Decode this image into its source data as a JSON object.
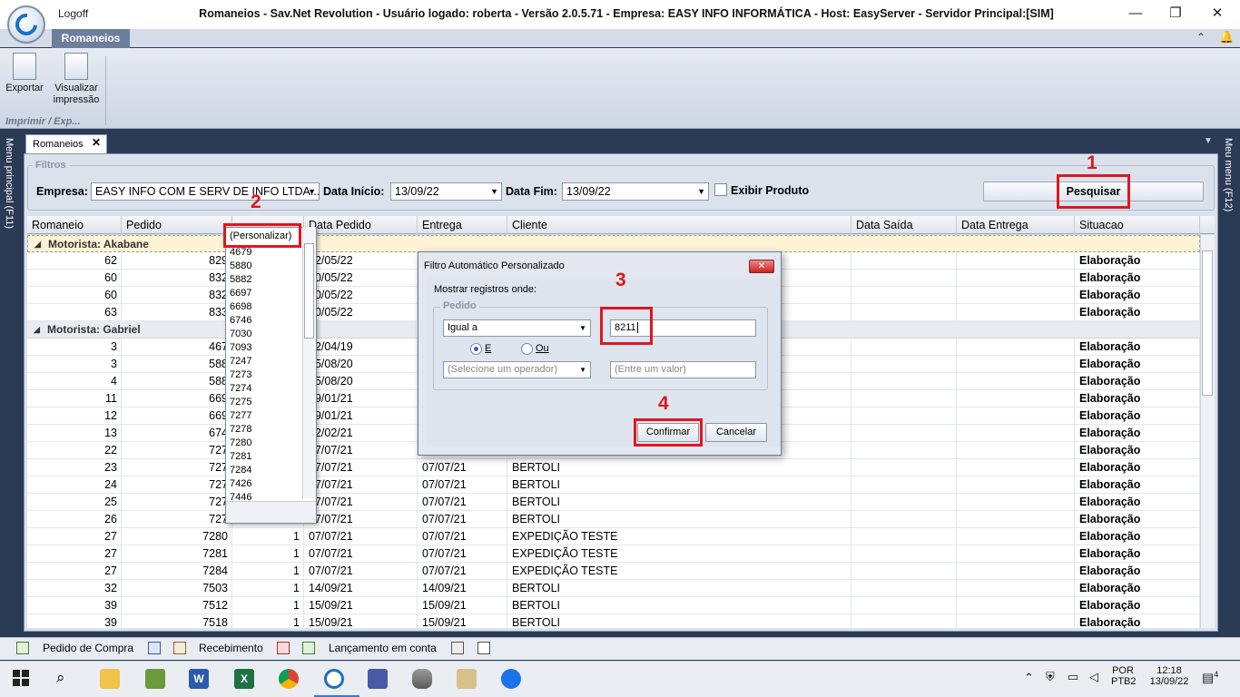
{
  "titlebar": {
    "logoff": "Logoff",
    "title": "Romaneios - Sav.Net Revolution - Usuário logado: roberta - Versão 2.0.5.71 - Empresa: EASY INFO INFORMÁTICA - Host: EasyServer - Servidor Principal:[SIM]",
    "minimize": "—",
    "restore": "❐",
    "close": "✕"
  },
  "ribbon": {
    "tab": "Romaneios",
    "buttons": [
      {
        "label1": "Exportar",
        "label2": "",
        "icon": "floppy-disk-icon"
      },
      {
        "label1": "Visualizar",
        "label2": "impressão",
        "icon": "print-preview-icon"
      }
    ],
    "group_label": "Imprimir / Exp..."
  },
  "side": {
    "left": "Menu principal (F11)",
    "right": "Meu menu (F12)"
  },
  "doc_tab": {
    "label": "Romaneios",
    "close": "✕"
  },
  "filters": {
    "legend": "Filtros",
    "empresa_label": "Empresa:",
    "empresa_value": "EASY INFO COM E SERV DE INFO LTDA...",
    "inicio_label": "Data Início:",
    "inicio_value": "13/09/22",
    "fim_label": "Data Fim:",
    "fim_value": "13/09/22",
    "exibir_label": "Exibir Produto",
    "pesquisar": "Pesquisar"
  },
  "annotations": [
    "1",
    "2",
    "3",
    "4"
  ],
  "grid": {
    "columns": [
      "Romaneio",
      "Pedido",
      "",
      "Data Pedido",
      "Entrega",
      "Cliente",
      "Data Saída",
      "Data Entrega",
      "Situacao"
    ],
    "groups": [
      {
        "label": "Motorista: Akabane",
        "rows": [
          {
            "romaneio": "62",
            "pedido": "829",
            "qtd": "",
            "data_pedido": "12/05/22",
            "entrega": "",
            "cliente": "",
            "situacao": "Elaboração"
          },
          {
            "romaneio": "60",
            "pedido": "832",
            "qtd": "",
            "data_pedido": "10/05/22",
            "entrega": "",
            "cliente": "",
            "situacao": "Elaboração"
          },
          {
            "romaneio": "60",
            "pedido": "832",
            "qtd": "",
            "data_pedido": "10/05/22",
            "entrega": "",
            "cliente": "",
            "situacao": "Elaboração"
          },
          {
            "romaneio": "63",
            "pedido": "833",
            "qtd": "",
            "data_pedido": "10/05/22",
            "entrega": "",
            "cliente": "",
            "situacao": "Elaboração"
          }
        ]
      },
      {
        "label": "Motorista: Gabriel",
        "rows": [
          {
            "romaneio": "3",
            "pedido": "467",
            "qtd": "",
            "data_pedido": "12/04/19",
            "entrega": "",
            "cliente": "",
            "situacao": "Elaboração"
          },
          {
            "romaneio": "3",
            "pedido": "588",
            "qtd": "",
            "data_pedido": "15/08/20",
            "entrega": "",
            "cliente": "",
            "situacao": "Elaboração"
          },
          {
            "romaneio": "4",
            "pedido": "588",
            "qtd": "",
            "data_pedido": "15/08/20",
            "entrega": "",
            "cliente": "",
            "situacao": "Elaboração"
          },
          {
            "romaneio": "11",
            "pedido": "669",
            "qtd": "",
            "data_pedido": "19/01/21",
            "entrega": "",
            "cliente": "",
            "situacao": "Elaboração"
          },
          {
            "romaneio": "12",
            "pedido": "669",
            "qtd": "",
            "data_pedido": "19/01/21",
            "entrega": "",
            "cliente": "",
            "situacao": "Elaboração"
          },
          {
            "romaneio": "13",
            "pedido": "674",
            "qtd": "",
            "data_pedido": "12/02/21",
            "entrega": "",
            "cliente": "",
            "situacao": "Elaboração"
          },
          {
            "romaneio": "22",
            "pedido": "727",
            "qtd": "",
            "data_pedido": "07/07/21",
            "entrega": "",
            "cliente": "",
            "situacao": "Elaboração"
          },
          {
            "romaneio": "23",
            "pedido": "727",
            "qtd": "",
            "data_pedido": "07/07/21",
            "entrega": "07/07/21",
            "cliente": "BERTOLI",
            "situacao": "Elaboração"
          },
          {
            "romaneio": "24",
            "pedido": "727",
            "qtd": "",
            "data_pedido": "07/07/21",
            "entrega": "07/07/21",
            "cliente": "BERTOLI",
            "situacao": "Elaboração"
          },
          {
            "romaneio": "25",
            "pedido": "727",
            "qtd": "",
            "data_pedido": "07/07/21",
            "entrega": "07/07/21",
            "cliente": "BERTOLI",
            "situacao": "Elaboração"
          },
          {
            "romaneio": "26",
            "pedido": "727",
            "qtd": "",
            "data_pedido": "07/07/21",
            "entrega": "07/07/21",
            "cliente": "BERTOLI",
            "situacao": "Elaboração"
          },
          {
            "romaneio": "27",
            "pedido": "7280",
            "qtd": "1",
            "data_pedido": "07/07/21",
            "entrega": "07/07/21",
            "cliente": "EXPEDIÇÃO TESTE",
            "situacao": "Elaboração"
          },
          {
            "romaneio": "27",
            "pedido": "7281",
            "qtd": "1",
            "data_pedido": "07/07/21",
            "entrega": "07/07/21",
            "cliente": "EXPEDIÇÃO TESTE",
            "situacao": "Elaboração"
          },
          {
            "romaneio": "27",
            "pedido": "7284",
            "qtd": "1",
            "data_pedido": "07/07/21",
            "entrega": "07/07/21",
            "cliente": "EXPEDIÇÃO TESTE",
            "situacao": "Elaboração"
          },
          {
            "romaneio": "32",
            "pedido": "7503",
            "qtd": "1",
            "data_pedido": "14/09/21",
            "entrega": "14/09/21",
            "cliente": "BERTOLI",
            "situacao": "Elaboração"
          },
          {
            "romaneio": "39",
            "pedido": "7512",
            "qtd": "1",
            "data_pedido": "15/09/21",
            "entrega": "15/09/21",
            "cliente": "BERTOLI",
            "situacao": "Elaboração"
          },
          {
            "romaneio": "39",
            "pedido": "7518",
            "qtd": "1",
            "data_pedido": "15/09/21",
            "entrega": "15/09/21",
            "cliente": "BERTOLI",
            "situacao": "Elaboração"
          }
        ]
      }
    ]
  },
  "dropdown": {
    "first": "(Personalizar)",
    "items": [
      "4679",
      "5880",
      "5882",
      "6697",
      "6698",
      "6746",
      "7030",
      "7093",
      "7247",
      "7273",
      "7274",
      "7275",
      "7277",
      "7278",
      "7280",
      "7281",
      "7284",
      "7426",
      "7446"
    ]
  },
  "dialog": {
    "title": "Filtro Automático Personalizado",
    "prompt": "Mostrar registros onde:",
    "group": "Pedido",
    "operator1": "Igual a",
    "value1": "8211",
    "radio_e": "E",
    "radio_ou": "Ou",
    "operator2_placeholder": "(Selecione um operador)",
    "value2_placeholder": "(Entre um valor)",
    "confirm": "Confirmar",
    "cancel": "Cancelar"
  },
  "statusbar": [
    "Pedido de Compra",
    "Recebimento",
    "Lançamento em conta"
  ],
  "taskbar": {
    "lang1": "POR",
    "lang2": "PTB2",
    "time": "12:18",
    "date": "13/09/22",
    "notif": "4"
  }
}
